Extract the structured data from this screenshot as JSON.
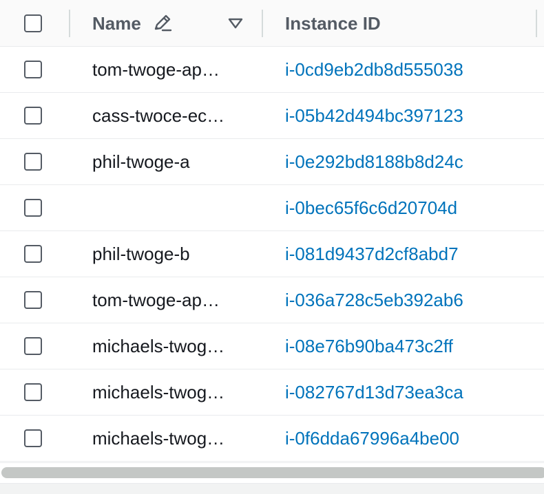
{
  "header": {
    "name_label": "Name",
    "instance_id_label": "Instance ID",
    "icons": {
      "edit": "pencil-edit-icon",
      "sort": "sort-triangle-down-icon",
      "checkbox": "empty-checkbox"
    }
  },
  "rows": [
    {
      "name": "tom-twoge-ap…",
      "instance_id": "i-0cd9eb2db8d555038"
    },
    {
      "name": "cass-twoce-ec…",
      "instance_id": "i-05b42d494bc397123"
    },
    {
      "name": "phil-twoge-a",
      "instance_id": "i-0e292bd8188b8d24c"
    },
    {
      "name": "",
      "instance_id": "i-0bec65f6c6d20704d"
    },
    {
      "name": "phil-twoge-b",
      "instance_id": "i-081d9437d2cf8abd7"
    },
    {
      "name": "tom-twoge-ap…",
      "instance_id": "i-036a728c5eb392ab6"
    },
    {
      "name": "michaels-twog…",
      "instance_id": "i-08e76b90ba473c2ff"
    },
    {
      "name": "michaels-twog…",
      "instance_id": "i-082767d13d73ea3ca"
    },
    {
      "name": "michaels-twog…",
      "instance_id": "i-0f6dda67996a4be00"
    }
  ],
  "colors": {
    "link": "#0073bb",
    "header_text": "#545b64",
    "body_text": "#16191f",
    "divider": "#e9ebed"
  }
}
